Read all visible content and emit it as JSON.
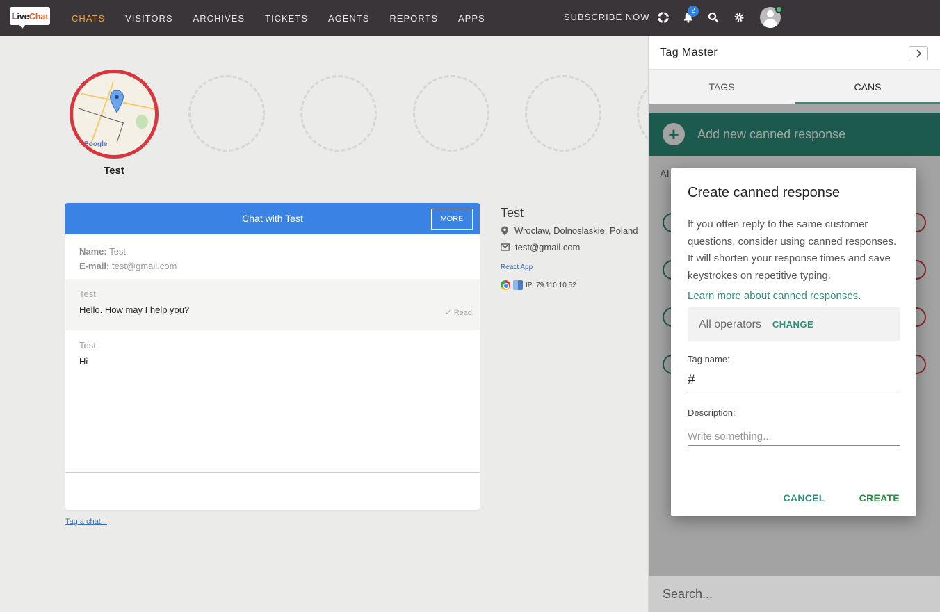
{
  "nav": {
    "logo_live": "Live",
    "logo_chat": "Chat",
    "items": [
      {
        "label": "CHATS",
        "active": true
      },
      {
        "label": "VISITORS"
      },
      {
        "label": "ARCHIVES"
      },
      {
        "label": "TICKETS"
      },
      {
        "label": "AGENTS"
      },
      {
        "label": "REPORTS"
      },
      {
        "label": "APPS"
      }
    ],
    "subscribe": "SUBSCRIBE NOW",
    "notification_count": "2",
    "icons": [
      "lifebuoy-icon",
      "bell-icon",
      "search-icon",
      "gear-icon"
    ],
    "accent_color": "#f0a33a"
  },
  "visitor": {
    "name": "Test",
    "map_brand": "Google"
  },
  "chat": {
    "header": "Chat with Test",
    "more_label": "MORE",
    "info_name_label": "Name:",
    "info_name": "Test",
    "info_email_label": "E-mail:",
    "info_email": "test@gmail.com",
    "messages": [
      {
        "author": "Test",
        "text": "Hello. How may I help you?",
        "status": "Read"
      },
      {
        "author": "Test",
        "text": "Hi"
      }
    ],
    "tag_link": "Tag a chat...",
    "header_color": "#3a83e4"
  },
  "details": {
    "name": "Test",
    "location": "Wroclaw, Dolnoslaskie, Poland",
    "email": "test@gmail.com",
    "app": "React App",
    "ip": "IP: 79.110.10.52"
  },
  "panel": {
    "title": "Tag Master",
    "tabs": [
      {
        "label": "TAGS"
      },
      {
        "label": "CANS",
        "active": true
      }
    ],
    "add_label": "Add new canned response",
    "list_label": "Al",
    "search_placeholder": "Search...",
    "accent_color": "#2e8e7a"
  },
  "modal": {
    "title": "Create canned response",
    "description": "If you often reply to the same customer questions, consider using canned responses. It will shorten your response times and save keystrokes on repetitive typing.",
    "learn_more": "Learn more about canned responses.",
    "operators": "All operators",
    "change": "CHANGE",
    "tag_label": "Tag name:",
    "tag_value": "#",
    "description_label": "Description:",
    "description_placeholder": "Write something...",
    "cancel": "CANCEL",
    "create": "CREATE"
  }
}
